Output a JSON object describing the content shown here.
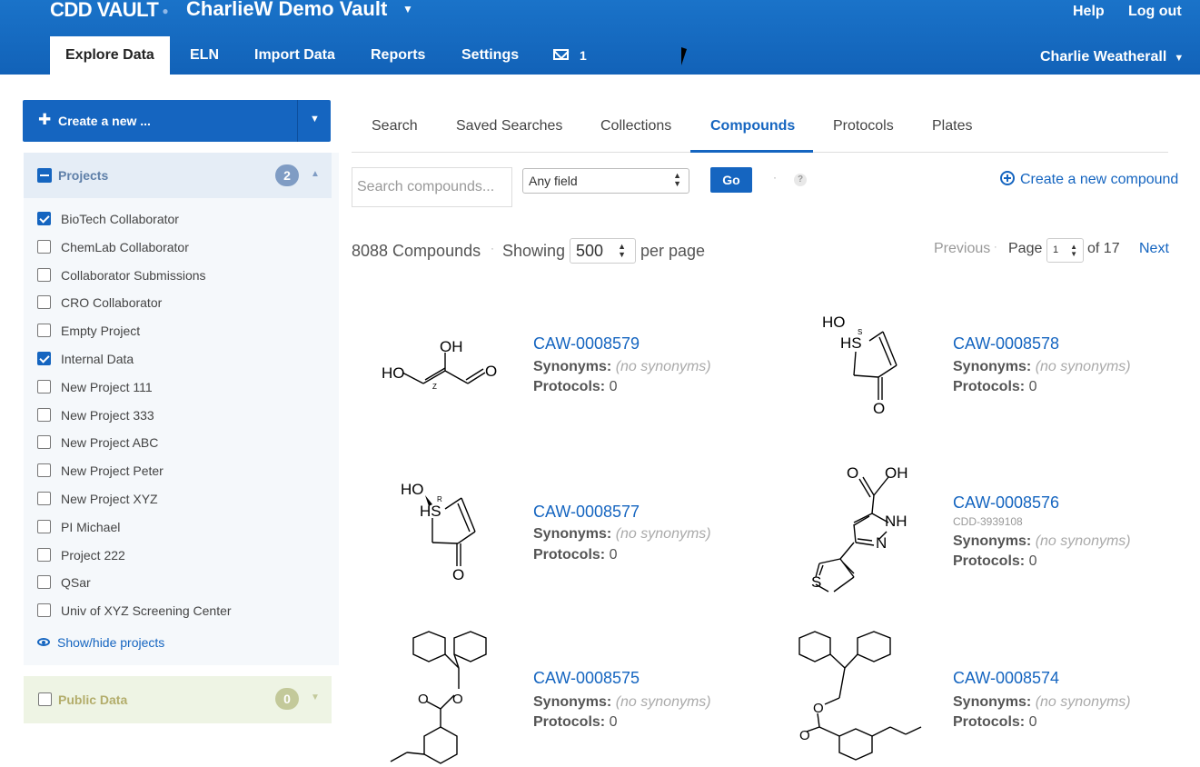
{
  "header": {
    "logo_text": "CDD VAULT",
    "vault_name": "CharlieW Demo Vault",
    "help": "Help",
    "logout": "Log out",
    "user": "Charlie Weatherall",
    "nav_tabs": [
      {
        "label": "Explore Data",
        "active": true
      },
      {
        "label": "ELN"
      },
      {
        "label": "Import Data"
      },
      {
        "label": "Reports"
      },
      {
        "label": "Settings"
      }
    ],
    "messages_count": "1",
    "colors": {
      "brand": "#1565c0"
    }
  },
  "sidebar": {
    "create_label": "Create a new ...",
    "projects": {
      "title": "Projects",
      "count": "2",
      "items": [
        {
          "label": "BioTech Collaborator",
          "checked": true
        },
        {
          "label": "ChemLab Collaborator",
          "checked": false
        },
        {
          "label": "Collaborator Submissions",
          "checked": false
        },
        {
          "label": "CRO Collaborator",
          "checked": false
        },
        {
          "label": "Empty Project",
          "checked": false
        },
        {
          "label": "Internal Data",
          "checked": true
        },
        {
          "label": "New Project 111",
          "checked": false
        },
        {
          "label": "New Project 333",
          "checked": false
        },
        {
          "label": "New Project ABC",
          "checked": false
        },
        {
          "label": "New Project Peter",
          "checked": false
        },
        {
          "label": "New Project XYZ",
          "checked": false
        },
        {
          "label": "PI Michael",
          "checked": false
        },
        {
          "label": "Project 222",
          "checked": false
        },
        {
          "label": "QSar",
          "checked": false
        },
        {
          "label": "Univ of XYZ Screening Center",
          "checked": false
        }
      ],
      "show_hide": "Show/hide projects"
    },
    "public": {
      "title": "Public Data",
      "count": "0"
    }
  },
  "main": {
    "sub_tabs": [
      {
        "label": "Search"
      },
      {
        "label": "Saved Searches"
      },
      {
        "label": "Collections"
      },
      {
        "label": "Compounds",
        "active": true
      },
      {
        "label": "Protocols"
      },
      {
        "label": "Plates"
      }
    ],
    "search": {
      "placeholder": "Search compounds...",
      "field": "Any field",
      "go": "Go",
      "help": "?",
      "create_compound": "Create a new compound"
    },
    "results": {
      "count_text": "8088 Compounds",
      "showing": "Showing",
      "per_page_value": "500",
      "per_page_label": "per page",
      "previous": "Previous",
      "page_label": "Page",
      "page_value": "1",
      "of_label": "of 17",
      "next": "Next"
    },
    "compounds": [
      {
        "id": "CAW-0008579",
        "synonyms_label": "Synonyms:",
        "synonyms": "(no synonyms)",
        "protocols_label": "Protocols:",
        "protocols": "0",
        "structure": "hydroxy-enal"
      },
      {
        "id": "CAW-0008578",
        "synonyms_label": "Synonyms:",
        "synonyms": "(no synonyms)",
        "protocols_label": "Protocols:",
        "protocols": "0",
        "structure": "hydroxythiophenone-S"
      },
      {
        "id": "CAW-0008577",
        "synonyms_label": "Synonyms:",
        "synonyms": "(no synonyms)",
        "protocols_label": "Protocols:",
        "protocols": "0",
        "structure": "hydroxythiophenone-R"
      },
      {
        "id": "CAW-0008576",
        "alt_id": "CDD-3939108",
        "synonyms_label": "Synonyms:",
        "synonyms": "(no synonyms)",
        "protocols_label": "Protocols:",
        "protocols": "0",
        "structure": "thienyl-pyrazole-carboxylic-acid"
      },
      {
        "id": "CAW-0008575",
        "synonyms_label": "Synonyms:",
        "synonyms": "(no synonyms)",
        "protocols_label": "Protocols:",
        "protocols": "0",
        "structure": "fluorenyl-ester-cyclohexyl"
      },
      {
        "id": "CAW-0008574",
        "synonyms_label": "Synonyms:",
        "synonyms": "(no synonyms)",
        "protocols_label": "Protocols:",
        "protocols": "0",
        "structure": "fluorenylmethyl-benzoate"
      }
    ],
    "structure_labels": {
      "ho": "HO",
      "oh": "OH",
      "o": "O",
      "hs": "HS",
      "s": "S",
      "nh": "NH",
      "n": "N",
      "z": "Z",
      "r": "R"
    }
  }
}
